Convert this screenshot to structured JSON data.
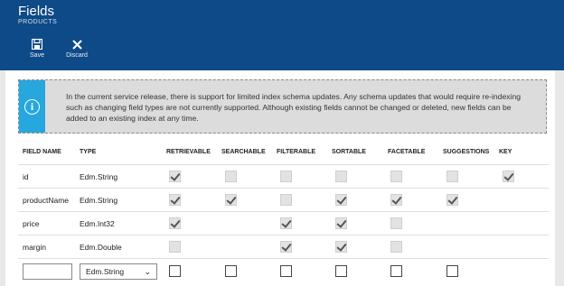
{
  "header": {
    "title": "Fields",
    "subtitle": "PRODUCTS",
    "save_label": "Save",
    "discard_label": "Discard",
    "bg_color": "#0e4a87"
  },
  "info": {
    "text": "In the current service release, there is support for limited index schema updates. Any schema updates that would require re-indexing such as changing field types are not currently supported. Although existing fields cannot be changed or deleted, new fields can be added to an existing index at any time.",
    "accent_color": "#26a8de"
  },
  "columns": [
    "FIELD NAME",
    "TYPE",
    "RETRIEVABLE",
    "SEARCHABLE",
    "FILTERABLE",
    "SORTABLE",
    "FACETABLE",
    "SUGGESTIONS",
    "KEY"
  ],
  "rows": [
    {
      "name": "id",
      "type": "Edm.String",
      "flags": [
        "on",
        "off",
        "off",
        "off",
        "off",
        "off",
        "on"
      ]
    },
    {
      "name": "productName",
      "type": "Edm.String",
      "flags": [
        "on",
        "on",
        "off",
        "on",
        "on",
        "on",
        "none"
      ]
    },
    {
      "name": "price",
      "type": "Edm.Int32",
      "flags": [
        "on",
        "none",
        "on",
        "on",
        "off",
        "none",
        "none"
      ]
    },
    {
      "name": "margin",
      "type": "Edm.Double",
      "flags": [
        "off",
        "none",
        "on",
        "on",
        "off",
        "none",
        "none"
      ]
    }
  ],
  "new_row": {
    "name_value": "",
    "type_value": "Edm.String",
    "flags": [
      "empty",
      "empty",
      "empty",
      "empty",
      "empty",
      "empty",
      "none"
    ]
  }
}
